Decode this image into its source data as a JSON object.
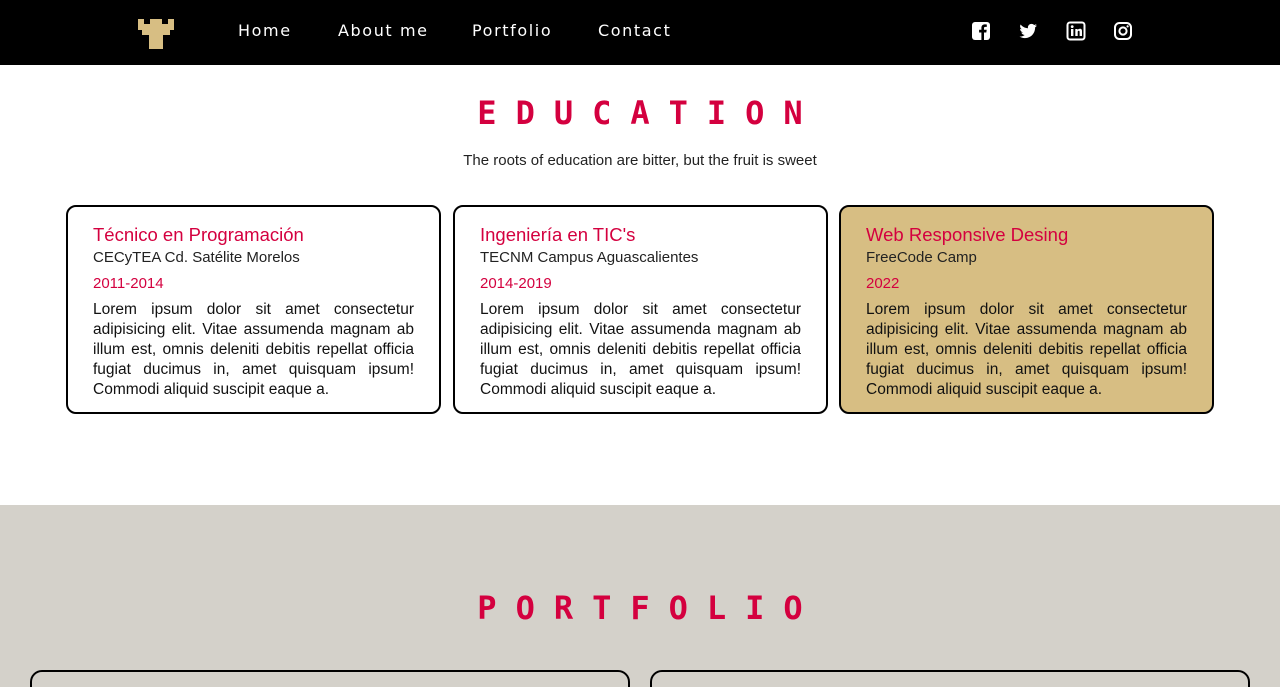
{
  "nav": {
    "logo_icon": "pixel-tower-logo-icon",
    "links": [
      "Home",
      "About me",
      "Portfolio",
      "Contact"
    ],
    "social_icons": [
      "facebook-icon",
      "twitter-icon",
      "linkedin-icon",
      "instagram-icon"
    ]
  },
  "education": {
    "title": "EDUCATION",
    "subtitle": "The roots of education are bitter, but the fruit is sweet",
    "cards": [
      {
        "title": "Técnico en Programación",
        "school": "CECyTEA Cd. Satélite Morelos",
        "years": "2011-2014",
        "description": "Lorem ipsum dolor sit amet consectetur adipisicing elit. Vitae assumenda magnam ab illum est, omnis deleniti debitis repellat officia fugiat ducimus in, amet quisquam ipsum! Commodi aliquid suscipit eaque a."
      },
      {
        "title": "Ingeniería en TIC's",
        "school": "TECNM Campus Aguascalientes",
        "years": "2014-2019",
        "description": "Lorem ipsum dolor sit amet consectetur adipisicing elit. Vitae assumenda magnam ab illum est, omnis deleniti debitis repellat officia fugiat ducimus in, amet quisquam ipsum! Commodi aliquid suscipit eaque a."
      },
      {
        "title": "Web Responsive Desing",
        "school": "FreeCode Camp",
        "years": "2022",
        "description": "Lorem ipsum dolor sit amet consectetur adipisicing elit. Vitae assumenda magnam ab illum est, omnis deleniti debitis repellat officia fugiat ducimus in, amet quisquam ipsum! Commodi aliquid suscipit eaque a."
      }
    ]
  },
  "portfolio": {
    "title": "PORTFOLIO"
  },
  "colors": {
    "accent": "#d4003f",
    "highlight_card": "#d7be83",
    "navbar": "#000000",
    "portfolio_bg": "#d4d1ca"
  }
}
